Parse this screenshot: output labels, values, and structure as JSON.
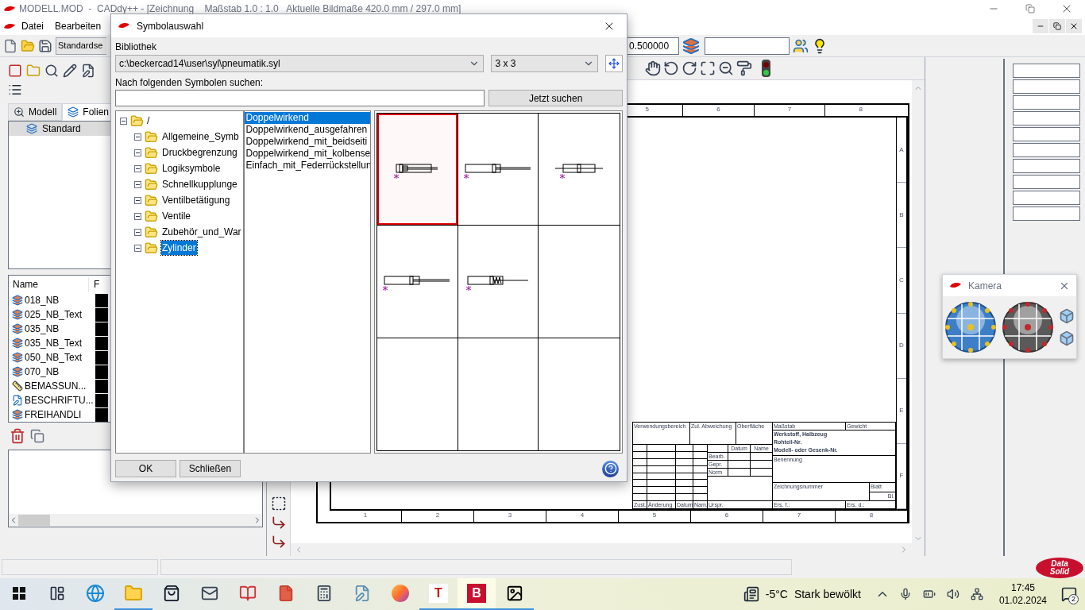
{
  "app": {
    "title": "MODELL.MOD  -  CADdy++ - [Zeichnung    Maßstab 1.0 : 1.0   Aktuelle Bildmaße 420.0 mm / 297.0 mm]"
  },
  "menu": [
    "Datei",
    "Bearbeiten"
  ],
  "toolbar": {
    "style_combo": "Standardse",
    "scale_field": "0.500000"
  },
  "left_panel": {
    "tabs": [
      {
        "label": "Modell",
        "selected": false
      },
      {
        "label": "Folien",
        "selected": true
      }
    ],
    "foils": [
      {
        "label": "Standard",
        "selected": true
      }
    ],
    "layer_columns": [
      "Name",
      "F"
    ],
    "layers": [
      {
        "name": "018_NB",
        "kind": "layer"
      },
      {
        "name": "025_NB_Text",
        "kind": "layer"
      },
      {
        "name": "035_NB",
        "kind": "layer"
      },
      {
        "name": "035_NB_Text",
        "kind": "layer"
      },
      {
        "name": "050_NB_Text",
        "kind": "layer"
      },
      {
        "name": "070_NB",
        "kind": "layer"
      },
      {
        "name": "BEMASSUN...",
        "kind": "dimension"
      },
      {
        "name": "BESCHRIFTU...",
        "kind": "label"
      },
      {
        "name": "FREIHANDLI",
        "kind": "layer"
      }
    ]
  },
  "drawing": {
    "top_columns": [
      "5",
      "6",
      "7",
      "8"
    ],
    "bottom_columns": [
      "1",
      "2",
      "3",
      "4",
      "5",
      "6",
      "7",
      "8"
    ],
    "rows": [
      "A",
      "B",
      "C",
      "D",
      "E",
      "F"
    ],
    "title_block": {
      "usage": "Verwendungsbereich",
      "tolerance": "Zul. Abweichung",
      "surface": "Oberfläche",
      "scale": "Maßstab",
      "weight": "Gewicht",
      "material": [
        "Werkstoff, Halbzeug",
        "Rohteil-Nr.",
        "Modell- oder Gesenk-Nr."
      ],
      "date": "Datum",
      "name": "Name",
      "roles": [
        "Bearb.",
        "Gepr.",
        "Norm"
      ],
      "designation": "Benennung",
      "drawing_number": "Zeichnungsnummer",
      "sheet": "Blatt",
      "sheets": "Bl.",
      "revision_cols": [
        "Zust.",
        "Änderung",
        "Datum",
        "Nam.",
        "Urspr."
      ],
      "replaces": "Ers. f.:",
      "replaced_by": "Ers. d.:"
    }
  },
  "dialog": {
    "title": "Symbolauswahl",
    "library_label": "Bibliothek",
    "library_path": "c:\\beckercad14\\user\\syl\\pneumatik.syl",
    "grid": "3 x 3",
    "search_label": "Nach folgenden Symbolen suchen:",
    "search_button": "Jetzt suchen",
    "tree": {
      "label": "/",
      "expanded": true,
      "children": [
        {
          "label": "Allgemeine_Symb",
          "selected": false
        },
        {
          "label": "Druckbegrenzung",
          "selected": false
        },
        {
          "label": "Logiksymbole",
          "selected": false
        },
        {
          "label": "Schnellkupplunge",
          "selected": false
        },
        {
          "label": "Ventilbetätigung",
          "selected": false
        },
        {
          "label": "Ventile",
          "selected": false
        },
        {
          "label": "Zubehör_und_War",
          "selected": false
        },
        {
          "label": "Zylinder",
          "selected": true
        }
      ]
    },
    "symbols": [
      {
        "label": "Doppelwirkend",
        "selected": true
      },
      {
        "label": "Doppelwirkend_ausgefahren",
        "selected": false
      },
      {
        "label": "Doppelwirkend_mit_beidseiti",
        "selected": false
      },
      {
        "label": "Doppelwirkend_mit_kolbense",
        "selected": false
      },
      {
        "label": "Einfach_mit_Federrückstellun",
        "selected": false
      }
    ],
    "previews": [
      {
        "kind": "retracted",
        "selected": true
      },
      {
        "kind": "extended",
        "selected": false
      },
      {
        "kind": "double_rod",
        "selected": false
      },
      {
        "kind": "cushioned",
        "selected": false
      },
      {
        "kind": "spring",
        "selected": false
      },
      {
        "kind": "empty",
        "selected": false
      },
      {
        "kind": "empty",
        "selected": false
      },
      {
        "kind": "empty",
        "selected": false
      },
      {
        "kind": "empty",
        "selected": false
      }
    ],
    "buttons": [
      "OK",
      "Schließen"
    ]
  },
  "camera": {
    "title": "Kamera"
  },
  "logo": {
    "line1": "Data",
    "line2": "Solid"
  },
  "taskbar": {
    "apps": [
      {
        "kind": "start",
        "running": false,
        "selected": false
      },
      {
        "kind": "task_view",
        "running": false,
        "selected": false
      },
      {
        "kind": "browser",
        "running": false,
        "selected": false
      },
      {
        "kind": "files",
        "running": true,
        "selected": false
      },
      {
        "kind": "store",
        "running": false,
        "selected": false
      },
      {
        "kind": "mail",
        "running": false,
        "selected": false
      },
      {
        "kind": "reader",
        "running": false,
        "selected": false
      },
      {
        "kind": "document",
        "running": false,
        "selected": false
      },
      {
        "kind": "calculator",
        "running": false,
        "selected": false
      },
      {
        "kind": "notes",
        "running": false,
        "selected": false
      },
      {
        "kind": "firefox",
        "running": false,
        "selected": false
      },
      {
        "kind": "letter",
        "glyph": "T",
        "running": true,
        "selected": false
      },
      {
        "kind": "letter",
        "glyph": "B",
        "running": true,
        "selected": true
      },
      {
        "kind": "photos",
        "running": true,
        "selected": false
      }
    ],
    "temperature": "-5°C",
    "weather": "Stark bewölkt",
    "time": "17:45",
    "date": "01.02.2024",
    "notifications": "2"
  }
}
